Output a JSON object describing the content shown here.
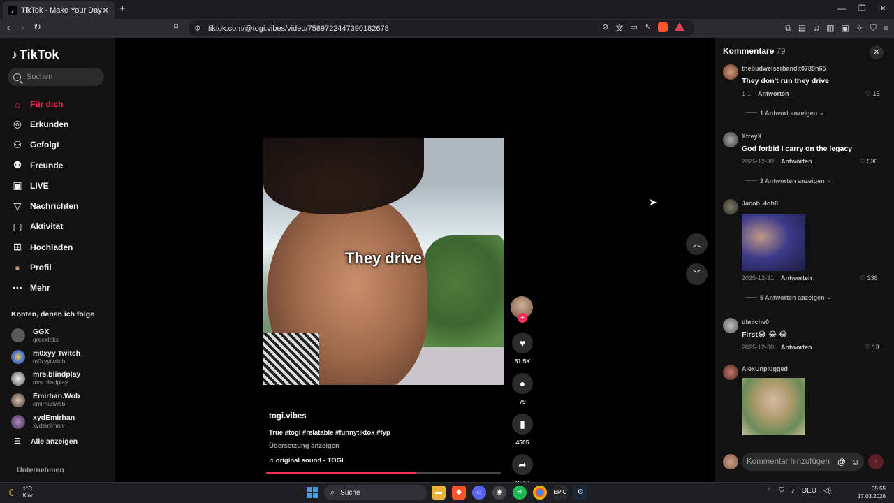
{
  "browser": {
    "tab_title": "TikTok - Make Your Day",
    "tab_close": "✕",
    "new_tab": "+",
    "url": "tiktok.com/@togi.vibes/video/7589722447390182678"
  },
  "sidebar": {
    "logo": "TikTok",
    "search_placeholder": "Suchen",
    "menu": [
      {
        "label": "Für dich",
        "icon": "home-icon",
        "glyph": "⌂"
      },
      {
        "label": "Erkunden",
        "icon": "compass-icon",
        "glyph": "◎"
      },
      {
        "label": "Gefolgt",
        "icon": "following-icon",
        "glyph": "⚇"
      },
      {
        "label": "Freunde",
        "icon": "friends-icon",
        "glyph": "⚉"
      },
      {
        "label": "LIVE",
        "icon": "live-icon",
        "glyph": "▣"
      },
      {
        "label": "Nachrichten",
        "icon": "messages-icon",
        "glyph": "▽"
      },
      {
        "label": "Aktivität",
        "icon": "activity-icon",
        "glyph": "▢"
      },
      {
        "label": "Hochladen",
        "icon": "upload-icon",
        "glyph": "⊞"
      },
      {
        "label": "Profil",
        "icon": "profile-icon",
        "glyph": "●"
      },
      {
        "label": "Mehr",
        "icon": "more-icon",
        "glyph": "⋯"
      }
    ],
    "following_title": "Konten, denen ich folge",
    "following": [
      {
        "name": "GGX",
        "handle": "greektokx",
        "color": "#5a5a5a"
      },
      {
        "name": "m0xyy Twitch",
        "handle": "m0xyytwitch",
        "color": "#3c6fd1"
      },
      {
        "name": "mrs.blindplay",
        "handle": "mrs.blindplay",
        "color": "#cfcfcf"
      },
      {
        "name": "Emirhan.Wob",
        "handle": "emirhanwob",
        "color": "#8d7b6e"
      },
      {
        "name": "xydEmirhan",
        "handle": "xydemirhan",
        "color": "#6b4f7a"
      }
    ],
    "show_all": "Alle anzeigen",
    "company": "Unternehmen"
  },
  "video": {
    "overlay_text": "They drive",
    "author": "togi.vibes",
    "description": "True #togi #relatable #funnytiktok #fyp",
    "translation": "Übersetzung anzeigen",
    "sound": "original sound - TOGI",
    "progress": 0.64,
    "likes": "51.5K",
    "comments": "79",
    "saves": "4505",
    "shares": "10.1K"
  },
  "comments": {
    "title": "Kommentare",
    "count": "79",
    "items": [
      {
        "user": "thebudweiserbandit0789n65",
        "text": "They don't run they drive",
        "date": "1-1",
        "reply": "Antworten",
        "likes": "15",
        "more": "1 Antwort anzeigen",
        "avatar": "#a6674f"
      },
      {
        "user": "XtreyX",
        "text": "God forbid I carry on the legacy",
        "date": "2025-12-30",
        "reply": "Antworten",
        "likes": "536",
        "more": "2 Antworten anzeigen",
        "avatar": "#6f6f6f"
      },
      {
        "user": "Jacob .4oh8",
        "text": "",
        "date": "2025-12-31",
        "reply": "Antworten",
        "likes": "338",
        "more": "5 Antworten anzeigen",
        "avatar": "#5b5b4c"
      },
      {
        "user": "dlmiche0",
        "text": "First😂 😂 😂",
        "date": "2025-12-30",
        "reply": "Antworten",
        "likes": "13",
        "more": "",
        "avatar": "#8a8a8a"
      },
      {
        "user": "AlexUnplugged",
        "text": "",
        "date": "",
        "reply": "",
        "likes": "",
        "more": "",
        "avatar": "#7a4a45"
      }
    ],
    "input_placeholder": "Kommentar hinzufügen"
  },
  "taskbar": {
    "temp": "1°C",
    "weather": "Klar",
    "search": "Suche",
    "lang": "DEU",
    "time": "05:55",
    "date": "17.03.2026"
  }
}
